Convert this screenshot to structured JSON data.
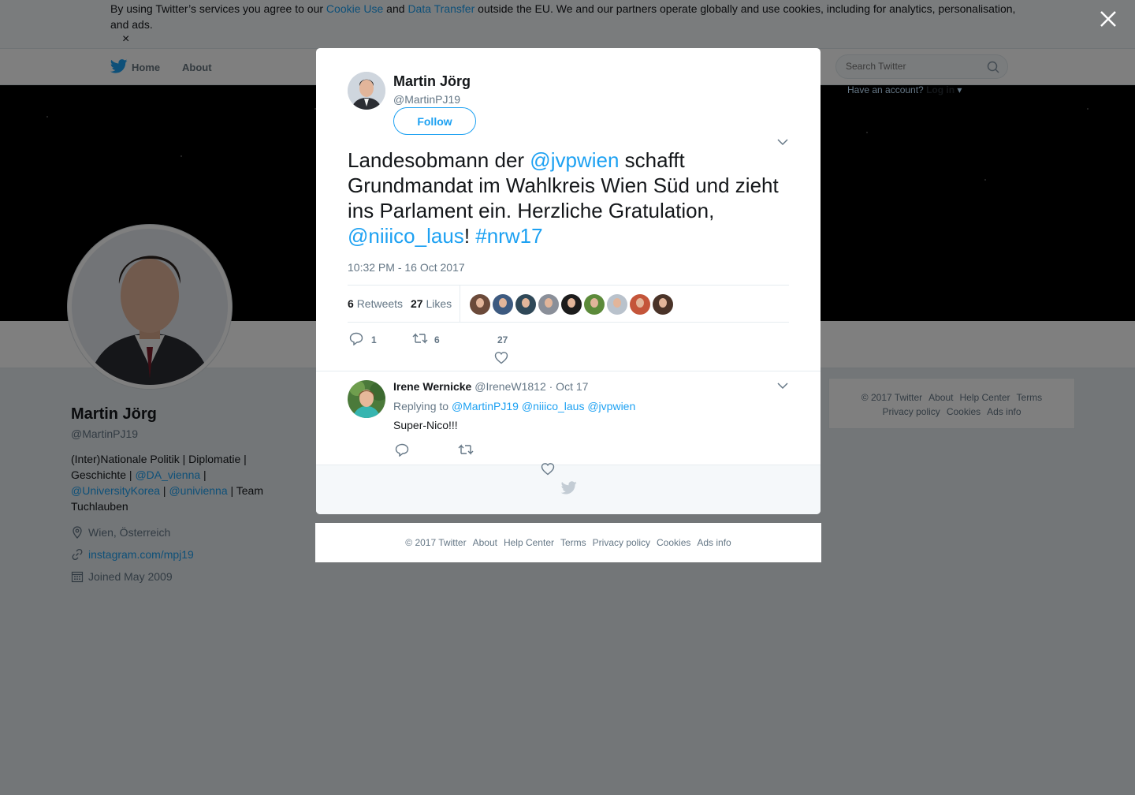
{
  "cookie_banner": {
    "text_before": "By using Twitter’s services you agree to our ",
    "link_cookie_use": "Cookie Use",
    "text_and": " and ",
    "link_data_transfer": "Data Transfer",
    "text_after": " outside the EU. We and our partners operate globally and use cookies, including for analytics, personalisation, and ads.",
    "dismiss_glyph": "×"
  },
  "nav": {
    "home_label": "Home",
    "about_label": "About",
    "search_placeholder": "Search Twitter",
    "login_prompt": "Have an account?",
    "login_label": "Log in"
  },
  "profile": {
    "name": "Martin Jörg",
    "handle": "@MartinPJ19",
    "bio_1": "(Inter)Nationale Politik | Diplomatie | Geschichte | ",
    "bio_link_1": "@DA_vienna",
    "bio_2": " | ",
    "bio_link_2": "@UniversityKorea",
    "bio_3": " | ",
    "bio_link_3": "@univienna",
    "bio_4": " | Team Tuchlauben",
    "location": "Wien, Österreich",
    "website": "instagram.com/mpj19",
    "joined": "Joined May 2009"
  },
  "side_footer": {
    "links": [
      "© 2017 Twitter",
      "About",
      "Help Center",
      "Terms",
      "Privacy policy",
      "Cookies",
      "Ads info"
    ]
  },
  "tweet": {
    "author_name": "Martin Jörg",
    "author_handle": "@MartinPJ19",
    "follow_label": "Follow",
    "text_1": "Landesobmann der ",
    "mention_1": "@jvpwien",
    "text_2": " schafft Grundmandat im Wahlkreis Wien Süd und zieht ins Parlament ein. Herzliche Gratulation, ",
    "mention_2": "@niiico_laus",
    "text_3": "! ",
    "hashtag": "#nrw17",
    "timestamp": "10:32 PM - 16 Oct 2017",
    "retweets_count": "6",
    "retweets_label": "Retweets",
    "likes_count": "27",
    "likes_label": "Likes",
    "likers_count": 9,
    "action_reply_count": "1",
    "action_retweet_count": "6",
    "action_like_count": "27"
  },
  "reply": {
    "author_name": "Irene Wernicke",
    "author_handle": "@IreneW1812",
    "date": "· Oct 17",
    "replying_to_label": "Replying to ",
    "replying_to_1": "@MartinPJ19",
    "replying_to_2": "@niiico_laus",
    "replying_to_3": "@jvpwien",
    "text": "Super-Nico!!!"
  },
  "modal_footer": {
    "links": [
      "© 2017 Twitter",
      "About",
      "Help Center",
      "Terms",
      "Privacy policy",
      "Cookies",
      "Ads info"
    ]
  },
  "colors": {
    "brand_blue": "#1da1f2",
    "overlay": "rgba(0,0,0,0.5)",
    "text_secondary": "#657786"
  },
  "icons": [
    "twitter-bird-icon",
    "search-icon",
    "close-icon",
    "location-pin-icon",
    "link-icon",
    "calendar-icon",
    "reply-icon",
    "retweet-icon",
    "heart-icon",
    "chevron-down-icon"
  ]
}
